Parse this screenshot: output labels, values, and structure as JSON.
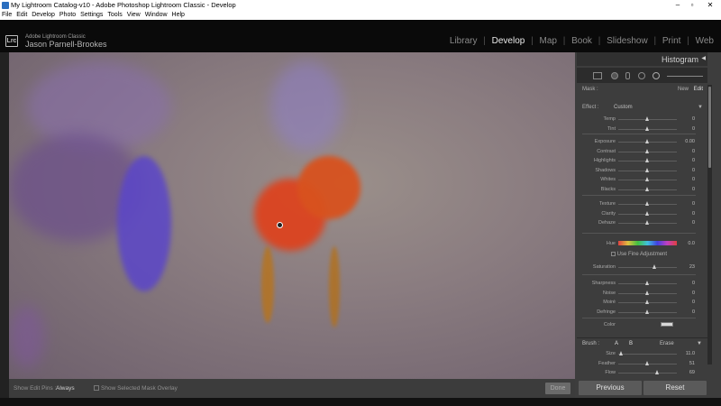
{
  "window": {
    "title": "My Lightroom Catalog-v10 - Adobe Photoshop Lightroom Classic - Develop",
    "min_glyph": "–",
    "max_glyph": "▫",
    "close_glyph": "✕"
  },
  "menu": [
    "File",
    "Edit",
    "Develop",
    "Photo",
    "Settings",
    "Tools",
    "View",
    "Window",
    "Help"
  ],
  "identity": {
    "badge": "Lrc",
    "product": "Adobe Lightroom Classic",
    "user": "Jason Parnell-Brookes"
  },
  "modules": [
    "Library",
    "Develop",
    "Map",
    "Book",
    "Slideshow",
    "Print",
    "Web"
  ],
  "active_module": "Develop",
  "toolbar": {
    "show_edit_pins_label": "Show Edit Pins :",
    "show_edit_pins_value": "Always",
    "show_mask_overlay_label": "Show Selected Mask Overlay",
    "done_label": "Done"
  },
  "panel": {
    "header": "Histogram",
    "collapse_glyph": "◀",
    "mask_label": "Mask :",
    "new_label": "New",
    "edit_label": "Edit",
    "effect_label": "Effect :",
    "effect_value": "Custom",
    "hue_label": "Hue",
    "hue_value": "0.0",
    "use_fine_adjustment": "Use Fine Adjustment",
    "color_label": "Color",
    "sliders_group1": [
      {
        "label": "Temp",
        "value": "0",
        "pos": 0.5
      },
      {
        "label": "Tint",
        "value": "0",
        "pos": 0.5
      }
    ],
    "sliders_group2": [
      {
        "label": "Exposure",
        "value": "0.00",
        "pos": 0.5
      },
      {
        "label": "Contrast",
        "value": "0",
        "pos": 0.5
      },
      {
        "label": "Highlights",
        "value": "0",
        "pos": 0.5
      },
      {
        "label": "Shadows",
        "value": "0",
        "pos": 0.5
      },
      {
        "label": "Whites",
        "value": "0",
        "pos": 0.5
      },
      {
        "label": "Blacks",
        "value": "0",
        "pos": 0.5
      }
    ],
    "sliders_group3": [
      {
        "label": "Texture",
        "value": "0",
        "pos": 0.5
      },
      {
        "label": "Clarity",
        "value": "0",
        "pos": 0.5
      },
      {
        "label": "Dehaze",
        "value": "0",
        "pos": 0.5
      }
    ],
    "saturation": {
      "label": "Saturation",
      "value": "23",
      "pos": 0.615
    },
    "sliders_group4": [
      {
        "label": "Sharpness",
        "value": "0",
        "pos": 0.5
      },
      {
        "label": "Noise",
        "value": "0",
        "pos": 0.5
      },
      {
        "label": "Moiré",
        "value": "0",
        "pos": 0.5
      },
      {
        "label": "Defringe",
        "value": "0",
        "pos": 0.5
      }
    ],
    "brush": {
      "label": "Brush :",
      "a": "A",
      "b": "B",
      "erase": "Erase",
      "size": {
        "label": "Size",
        "value": "11.0"
      },
      "feather": {
        "label": "Feather",
        "value": "51"
      },
      "flow": {
        "label": "Flow",
        "value": "69"
      }
    }
  },
  "buttons": {
    "previous": "Previous",
    "reset": "Reset"
  },
  "colors": {
    "accent": "#e8e8e8",
    "panel_bg": "#3d3d3d",
    "mask_overlay": "#e0401a"
  }
}
